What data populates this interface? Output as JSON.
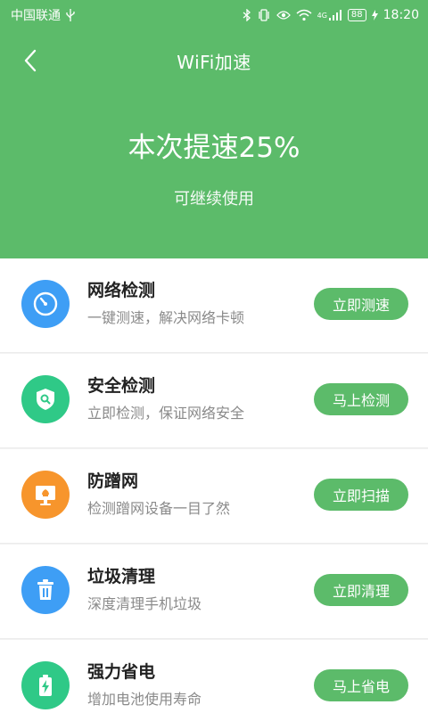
{
  "colors": {
    "primary": "#5cbb6a",
    "blue": "#3e9ef5",
    "green": "#2fc987",
    "orange": "#f7952c"
  },
  "status_bar": {
    "carrier": "中国联通",
    "usb_icon": "usb-icon",
    "battery": "88",
    "network": "4G",
    "time": "18:20"
  },
  "nav": {
    "back_icon": "chevron-left-icon",
    "title": "WiFi加速"
  },
  "result": {
    "title": "本次提速25%",
    "subtitle": "可继续使用"
  },
  "items": [
    {
      "icon": "clock-icon",
      "title": "网络检测",
      "desc": "一键测速，解决网络卡顿",
      "button": "立即测速"
    },
    {
      "icon": "shield-icon",
      "title": "安全检测",
      "desc": "立即检测，保证网络安全",
      "button": "马上检测"
    },
    {
      "icon": "monitor-icon",
      "title": "防蹭网",
      "desc": "检测蹭网设备一目了然",
      "button": "立即扫描"
    },
    {
      "icon": "trash-icon",
      "title": "垃圾清理",
      "desc": "深度清理手机垃圾",
      "button": "立即清理"
    },
    {
      "icon": "battery-icon",
      "title": "强力省电",
      "desc": "增加电池使用寿命",
      "button": "马上省电"
    }
  ]
}
